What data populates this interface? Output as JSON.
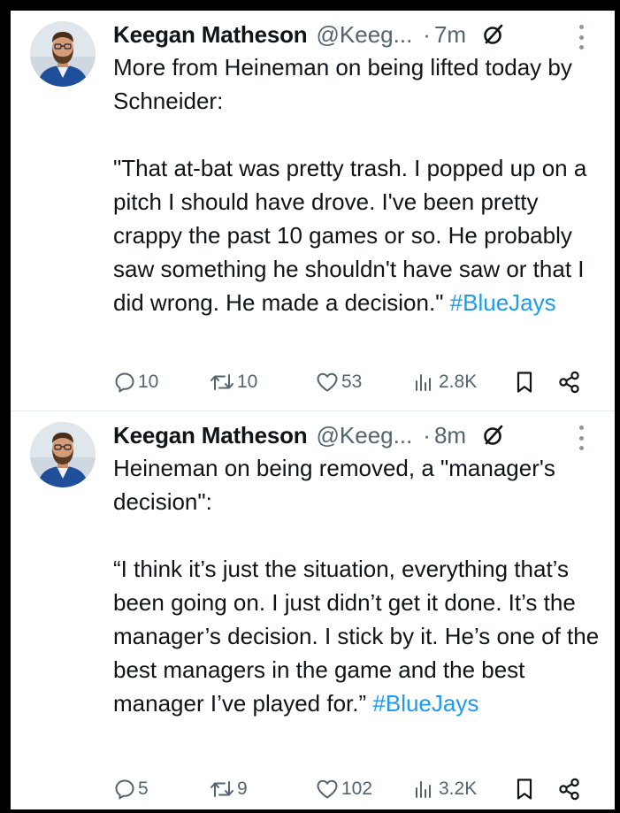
{
  "colors": {
    "text": "#0f1419",
    "secondary": "#536471",
    "link": "#1d9bf0",
    "divider": "#e6ecf0",
    "frame": "#000000"
  },
  "tweets": [
    {
      "author": {
        "name": "Keegan Matheson",
        "handle": "@Keeg...",
        "separator": "·",
        "time": "7m",
        "badge_icon": "no-entry-icon",
        "avatar_icon": "profile-photo"
      },
      "body": {
        "lines": [
          "More from Heineman on being lifted today by Schneider:",
          "\"That at-bat was pretty trash. I popped up on a pitch I should have drove. I've been pretty crappy the past 10 games or so. He probably saw something he shouldn't have saw or that I did wrong. He made a decision.\""
        ],
        "hashtag": "#BlueJays"
      },
      "stats": {
        "replies": "10",
        "retweets": "10",
        "likes": "53",
        "views": "2.8K"
      }
    },
    {
      "author": {
        "name": "Keegan Matheson",
        "handle": "@Keeg...",
        "separator": "·",
        "time": "8m",
        "badge_icon": "no-entry-icon",
        "avatar_icon": "profile-photo"
      },
      "body": {
        "lines": [
          "Heineman on being removed, a \"manager's decision\":",
          "“I think it’s just the situation, everything that’s been going on. I just didn’t get it done. It’s the manager’s decision. I stick by it. He’s one of the best managers in the game and the best manager I’ve played for.”"
        ],
        "hashtag": "#BlueJays"
      },
      "stats": {
        "replies": "5",
        "retweets": "9",
        "likes": "102",
        "views": "3.2K"
      }
    }
  ]
}
